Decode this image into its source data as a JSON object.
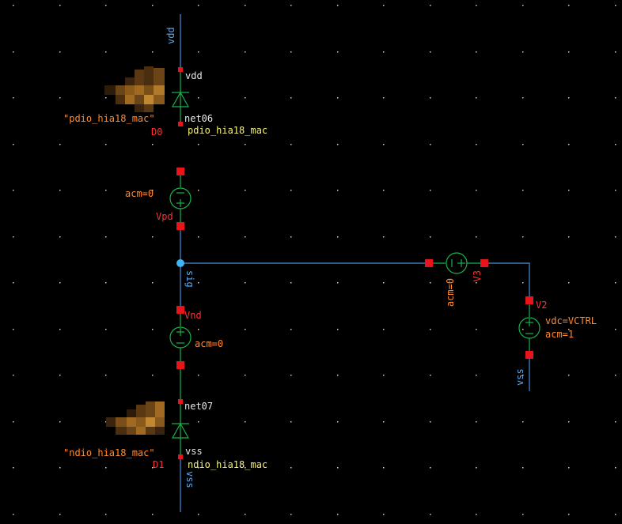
{
  "labels": {
    "vdd_net_top": "vdd",
    "vdd_pin": "vdd",
    "diode_top_model_quoted": "\"pdio_hia18_mac\"",
    "diode_top_name": "D0",
    "diode_top_net": "net06",
    "diode_top_model": "pdio_hia18_mac",
    "vpd_param": "acm=0",
    "vpd_name": "Vpd",
    "sig_net": "sig",
    "vnd_name": "Vnd",
    "vnd_param": "acm=0",
    "v3_param": "acm=0",
    "v3_name": "V3",
    "v2_name": "V2",
    "v2_param_vdc": "vdc=VCTRL",
    "v2_param_acm": "acm=1",
    "vss_net_right": "vss",
    "diode_bot_net": "net07",
    "diode_bot_model_quoted": "\"ndio_hia18_mac\"",
    "diode_bot_name": "D1",
    "diode_bot_pin": "vss",
    "diode_bot_model": "ndio_hia18_mac",
    "vss_net_bottom": "vss"
  },
  "colors": {
    "background": "#000000",
    "wire": "#4a90d9",
    "pin": "#e8141c",
    "device": "#17b34a",
    "instance_label": "#ff8a30",
    "net_label": "#f2f07a"
  }
}
